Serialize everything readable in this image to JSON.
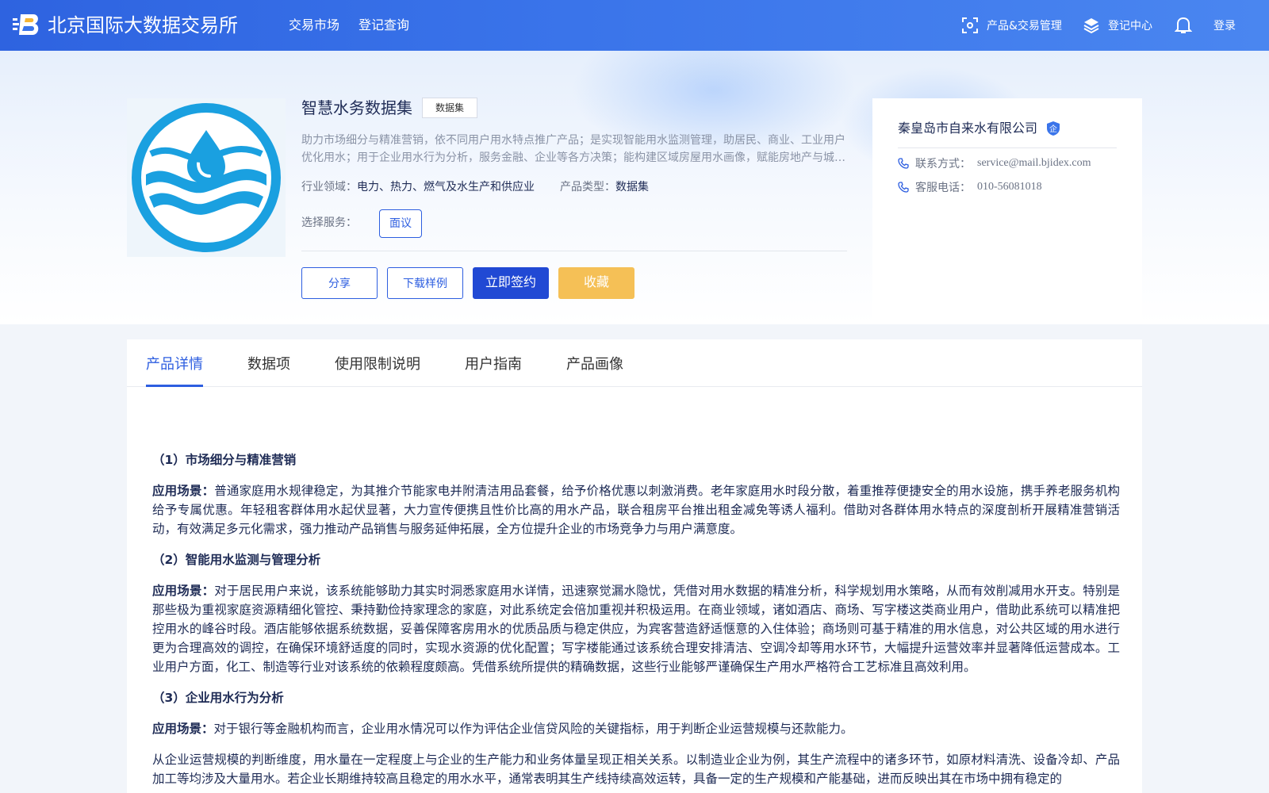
{
  "header": {
    "brand": "北京国际大数据交易所",
    "nav": [
      "交易市场",
      "登记查询"
    ],
    "product_mgmt": "产品&交易管理",
    "register_center": "登记中心",
    "login": "登录",
    "colors": {
      "bar": "#3a74ea",
      "accent": "#2d5ee0"
    }
  },
  "product": {
    "title": "智慧水务数据集",
    "tag": "数据集",
    "description": "助力市场细分与精准营销，依不同用户用水特点推广产品；是实现智能用水监测管理，助居民、商业、工业用户优化用水；用于企业用水行为分析，服务金融、企业等各方决策；能构建区域房屋用水画像，赋能房地产与城市规划等领域应用",
    "industry_label": "行业领域：",
    "industry": "电力、热力、燃气及水生产和供应业",
    "type_label": "产品类型：",
    "type": "数据集",
    "service_label": "选择服务：",
    "service_option": "面议",
    "image_icon": "water-drop-logo"
  },
  "actions": {
    "share": "分享",
    "download": "下载样例",
    "sign": "立即签约",
    "favorite": "收藏"
  },
  "company": {
    "name": "秦皇岛市自来水有限公司",
    "badge": "企",
    "contact_label": "联系方式：",
    "contact_value": "service@mail.bjidex.com",
    "phone_label": "客服电话：",
    "phone_value": "010-56081018"
  },
  "tabs": [
    "产品详情",
    "数据项",
    "使用限制说明",
    "用户指南",
    "产品画像"
  ],
  "article": {
    "sections": [
      {
        "heading": "（1）市场细分与精准营销",
        "label": "应用场景：",
        "text": "普通家庭用水规律稳定，为其推介节能家电并附清洁用品套餐，给予价格优惠以刺激消费。老年家庭用水时段分散，着重推荐便捷安全的用水设施，携手养老服务机构给予专属优惠。年轻租客群体用水起伏显著，大力宣传便携且性价比高的用水产品，联合租房平台推出租金减免等诱人福利。借助对各群体用水特点的深度剖析开展精准营销活动，有效满足多元化需求，强力推动产品销售与服务延伸拓展，全方位提升企业的市场竞争力与用户满意度。"
      },
      {
        "heading": "（2）智能用水监测与管理分析",
        "label": "应用场景：",
        "text": "对于居民用户来说，该系统能够助力其实时洞悉家庭用水详情，迅速察觉漏水隐忧，凭借对用水数据的精准分析，科学规划用水策略，从而有效削减用水开支。特别是那些极为重视家庭资源精细化管控、秉持勤俭持家理念的家庭，对此系统定会倍加重视并积极运用。在商业领域，诸如酒店、商场、写字楼这类商业用户，借助此系统可以精准把控用水的峰谷时段。酒店能够依据系统数据，妥善保障客房用水的优质品质与稳定供应，为宾客营造舒适惬意的入住体验；商场则可基于精准的用水信息，对公共区域的用水进行更为合理高效的调控，在确保环境舒适度的同时，实现水资源的优化配置；写字楼能通过该系统合理安排清洁、空调冷却等用水环节，大幅提升运营效率并显著降低运营成本。工业用户方面，化工、制造等行业对该系统的依赖程度颇高。凭借系统所提供的精确数据，这些行业能够严谨确保生产用水严格符合工艺标准且高效利用。"
      },
      {
        "heading": "（3）企业用水行为分析",
        "label": "应用场景：",
        "text": "对于银行等金融机构而言，企业用水情况可以作为评估企业信贷风险的关键指标，用于判断企业运营规模与还款能力。"
      }
    ],
    "trailing": "从企业运营规模的判断维度，用水量在一定程度上与企业的生产能力和业务体量呈现正相关关系。以制造业企业为例，其生产流程中的诸多环节，如原材料清洗、设备冷却、产品加工等均涉及大量用水。若企业长期维持较高且稳定的用水水平，通常表明其生产线持续高效运转，具备一定的生产规模和产能基础，进而反映出其在市场中拥有稳定的"
  }
}
